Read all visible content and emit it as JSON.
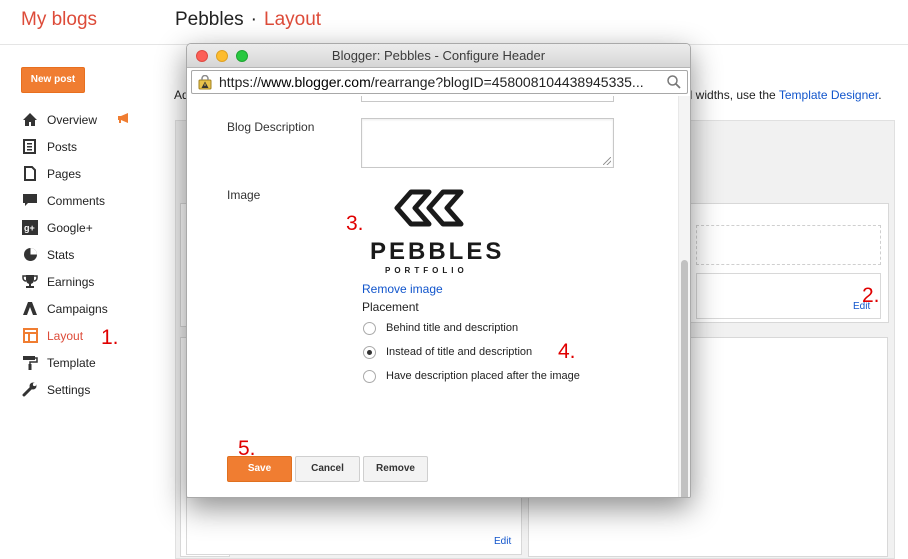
{
  "header": {
    "brand": "My blogs",
    "blog_name": "Pebbles",
    "separator": "·",
    "section": "Layout"
  },
  "sidebar": {
    "new_post": "New post",
    "items": [
      {
        "label": "Overview",
        "icon": "home-icon"
      },
      {
        "label": "Posts",
        "icon": "posts-icon"
      },
      {
        "label": "Pages",
        "icon": "pages-icon"
      },
      {
        "label": "Comments",
        "icon": "comments-icon"
      },
      {
        "label": "Google+",
        "icon": "google-plus-icon"
      },
      {
        "label": "Stats",
        "icon": "stats-icon"
      },
      {
        "label": "Earnings",
        "icon": "trophy-icon"
      },
      {
        "label": "Campaigns",
        "icon": "adwords-icon"
      },
      {
        "label": "Layout",
        "icon": "layout-icon",
        "active": true
      },
      {
        "label": "Template",
        "icon": "paint-roller-icon"
      },
      {
        "label": "Settings",
        "icon": "wrench-icon"
      }
    ]
  },
  "background": {
    "text_left": "Ad",
    "text_right_prefix": "nd widths, use the",
    "template_designer": "Template Designer",
    "text_right_suffix": ".",
    "edit_1": "Edit",
    "edit_2": "Edit"
  },
  "annotations": {
    "a1": "1.",
    "a2": "2.",
    "a3": "3.",
    "a4": "4.",
    "a5": "5."
  },
  "dialog": {
    "window_title": "Blogger: Pebbles - Configure Header",
    "url_prefix": "https://",
    "url_host": "www.blogger.com",
    "url_path": "/rearrange?blogID=458008104438945335...",
    "blog_description_label": "Blog Description",
    "blog_description_value": "",
    "image_label": "Image",
    "logo_title": "PEBBLES",
    "logo_subtitle": "PORTFOLIO",
    "remove_image": "Remove image",
    "placement_label": "Placement",
    "placement_options": [
      {
        "label": "Behind title and description",
        "selected": false
      },
      {
        "label": "Instead of title and description",
        "selected": true
      },
      {
        "label": "Have description placed after the image",
        "selected": false
      }
    ],
    "buttons": {
      "save": "Save",
      "cancel": "Cancel",
      "remove": "Remove"
    }
  },
  "colors": {
    "brand": "#dd4b39",
    "accent_button": "#f07d31",
    "link": "#1155cc",
    "annotation": "#e00000"
  }
}
